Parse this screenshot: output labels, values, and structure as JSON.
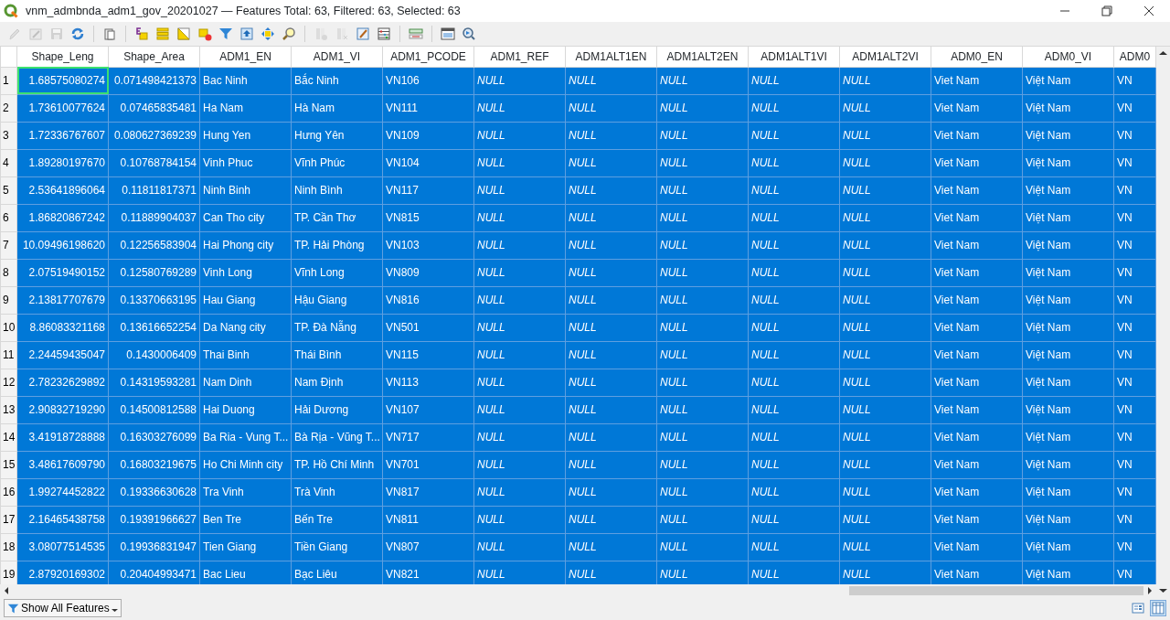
{
  "window": {
    "title": "vnm_admbnda_adm1_gov_20201027 — Features Total: 63, Filtered: 63, Selected: 63"
  },
  "toolbar": [
    {
      "kind": "pencil",
      "disabled": true
    },
    {
      "kind": "multiedit",
      "disabled": true
    },
    {
      "kind": "save",
      "disabled": true
    },
    {
      "kind": "reload",
      "disabled": false
    },
    {
      "kind": "sep"
    },
    {
      "kind": "paste",
      "disabled": false
    },
    {
      "kind": "sep"
    },
    {
      "kind": "expression",
      "disabled": false
    },
    {
      "kind": "selectall",
      "disabled": false
    },
    {
      "kind": "invert",
      "disabled": false
    },
    {
      "kind": "deselect",
      "disabled": false
    },
    {
      "kind": "filter",
      "disabled": false
    },
    {
      "kind": "movetop",
      "disabled": false
    },
    {
      "kind": "pan",
      "disabled": false
    },
    {
      "kind": "zoom",
      "disabled": false
    },
    {
      "kind": "sep"
    },
    {
      "kind": "newfield",
      "disabled": true
    },
    {
      "kind": "deletefield",
      "disabled": true
    },
    {
      "kind": "calculator",
      "disabled": false
    },
    {
      "kind": "abacus",
      "disabled": false
    },
    {
      "kind": "sep"
    },
    {
      "kind": "formatting",
      "disabled": false
    },
    {
      "kind": "sep"
    },
    {
      "kind": "dock",
      "disabled": false
    },
    {
      "kind": "actions",
      "disabled": false
    }
  ],
  "table": {
    "columns": [
      {
        "label": "Shape_Leng",
        "kind": "number"
      },
      {
        "label": "Shape_Area",
        "kind": "number"
      },
      {
        "label": "ADM1_EN",
        "kind": "text"
      },
      {
        "label": "ADM1_VI",
        "kind": "text"
      },
      {
        "label": "ADM1_PCODE",
        "kind": "text"
      },
      {
        "label": "ADM1_REF",
        "kind": "null"
      },
      {
        "label": "ADM1ALT1EN",
        "kind": "null"
      },
      {
        "label": "ADM1ALT2EN",
        "kind": "null"
      },
      {
        "label": "ADM1ALT1VI",
        "kind": "null"
      },
      {
        "label": "ADM1ALT2VI",
        "kind": "null"
      },
      {
        "label": "ADM0_EN",
        "kind": "text"
      },
      {
        "label": "ADM0_VI",
        "kind": "text"
      },
      {
        "label": "ADM0",
        "kind": "text"
      }
    ],
    "rows": [
      {
        "number": "1",
        "selected": true,
        "current": true,
        "cells": [
          "1.68575080274",
          "0.071498421373",
          "Bac Ninh",
          "Bắc Ninh",
          "VN106",
          "NULL",
          "NULL",
          "NULL",
          "NULL",
          "NULL",
          "Viet Nam",
          "Việt Nam",
          "VN"
        ]
      },
      {
        "number": "2",
        "selected": true,
        "current": false,
        "cells": [
          "1.73610077624",
          "0.07465835481",
          "Ha Nam",
          "Hà Nam",
          "VN111",
          "NULL",
          "NULL",
          "NULL",
          "NULL",
          "NULL",
          "Viet Nam",
          "Việt Nam",
          "VN"
        ]
      },
      {
        "number": "3",
        "selected": true,
        "current": false,
        "cells": [
          "1.72336767607",
          "0.080627369239",
          "Hung Yen",
          "Hưng Yên",
          "VN109",
          "NULL",
          "NULL",
          "NULL",
          "NULL",
          "NULL",
          "Viet Nam",
          "Việt Nam",
          "VN"
        ]
      },
      {
        "number": "4",
        "selected": true,
        "current": false,
        "cells": [
          "1.89280197670",
          "0.10768784154",
          "Vinh Phuc",
          "Vĩnh Phúc",
          "VN104",
          "NULL",
          "NULL",
          "NULL",
          "NULL",
          "NULL",
          "Viet Nam",
          "Việt Nam",
          "VN"
        ]
      },
      {
        "number": "5",
        "selected": true,
        "current": false,
        "cells": [
          "2.53641896064",
          "0.11811817371",
          "Ninh Binh",
          "Ninh Bình",
          "VN117",
          "NULL",
          "NULL",
          "NULL",
          "NULL",
          "NULL",
          "Viet Nam",
          "Việt Nam",
          "VN"
        ]
      },
      {
        "number": "6",
        "selected": true,
        "current": false,
        "cells": [
          "1.86820867242",
          "0.11889904037",
          "Can Tho city",
          "TP. Cần Thơ",
          "VN815",
          "NULL",
          "NULL",
          "NULL",
          "NULL",
          "NULL",
          "Viet Nam",
          "Việt Nam",
          "VN"
        ]
      },
      {
        "number": "7",
        "selected": true,
        "current": false,
        "cells": [
          "10.09496198620",
          "0.12256583904",
          "Hai Phong city",
          "TP. Hải Phòng",
          "VN103",
          "NULL",
          "NULL",
          "NULL",
          "NULL",
          "NULL",
          "Viet Nam",
          "Việt Nam",
          "VN"
        ]
      },
      {
        "number": "8",
        "selected": true,
        "current": false,
        "cells": [
          "2.07519490152",
          "0.12580769289",
          "Vinh Long",
          "Vĩnh Long",
          "VN809",
          "NULL",
          "NULL",
          "NULL",
          "NULL",
          "NULL",
          "Viet Nam",
          "Việt Nam",
          "VN"
        ]
      },
      {
        "number": "9",
        "selected": true,
        "current": false,
        "cells": [
          "2.13817707679",
          "0.13370663195",
          "Hau Giang",
          "Hậu Giang",
          "VN816",
          "NULL",
          "NULL",
          "NULL",
          "NULL",
          "NULL",
          "Viet Nam",
          "Việt Nam",
          "VN"
        ]
      },
      {
        "number": "10",
        "selected": true,
        "current": false,
        "cells": [
          "8.86083321168",
          "0.13616652254",
          "Da Nang city",
          "TP. Đà Nẵng",
          "VN501",
          "NULL",
          "NULL",
          "NULL",
          "NULL",
          "NULL",
          "Viet Nam",
          "Việt Nam",
          "VN"
        ]
      },
      {
        "number": "11",
        "selected": true,
        "current": false,
        "cells": [
          "2.24459435047",
          "0.1430006409",
          "Thai Binh",
          "Thái Bình",
          "VN115",
          "NULL",
          "NULL",
          "NULL",
          "NULL",
          "NULL",
          "Viet Nam",
          "Việt Nam",
          "VN"
        ]
      },
      {
        "number": "12",
        "selected": true,
        "current": false,
        "cells": [
          "2.78232629892",
          "0.14319593281",
          "Nam Dinh",
          "Nam Định",
          "VN113",
          "NULL",
          "NULL",
          "NULL",
          "NULL",
          "NULL",
          "Viet Nam",
          "Việt Nam",
          "VN"
        ]
      },
      {
        "number": "13",
        "selected": true,
        "current": false,
        "cells": [
          "2.90832719290",
          "0.14500812588",
          "Hai Duong",
          "Hải Dương",
          "VN107",
          "NULL",
          "NULL",
          "NULL",
          "NULL",
          "NULL",
          "Viet Nam",
          "Việt Nam",
          "VN"
        ]
      },
      {
        "number": "14",
        "selected": true,
        "current": false,
        "cells": [
          "3.41918728888",
          "0.16303276099",
          "Ba Ria - Vung T...",
          "Bà Rịa - Vũng T...",
          "VN717",
          "NULL",
          "NULL",
          "NULL",
          "NULL",
          "NULL",
          "Viet Nam",
          "Việt Nam",
          "VN"
        ]
      },
      {
        "number": "15",
        "selected": true,
        "current": false,
        "cells": [
          "3.48617609790",
          "0.16803219675",
          "Ho Chi Minh city",
          "TP. Hồ Chí Minh",
          "VN701",
          "NULL",
          "NULL",
          "NULL",
          "NULL",
          "NULL",
          "Viet Nam",
          "Việt Nam",
          "VN"
        ]
      },
      {
        "number": "16",
        "selected": true,
        "current": false,
        "cells": [
          "1.99274452822",
          "0.19336630628",
          "Tra Vinh",
          "Trà Vinh",
          "VN817",
          "NULL",
          "NULL",
          "NULL",
          "NULL",
          "NULL",
          "Viet Nam",
          "Việt Nam",
          "VN"
        ]
      },
      {
        "number": "17",
        "selected": true,
        "current": false,
        "cells": [
          "2.16465438758",
          "0.19391966627",
          "Ben Tre",
          "Bến Tre",
          "VN811",
          "NULL",
          "NULL",
          "NULL",
          "NULL",
          "NULL",
          "Viet Nam",
          "Việt Nam",
          "VN"
        ]
      },
      {
        "number": "18",
        "selected": true,
        "current": false,
        "cells": [
          "3.08077514535",
          "0.19936831947",
          "Tien Giang",
          "Tiền Giang",
          "VN807",
          "NULL",
          "NULL",
          "NULL",
          "NULL",
          "NULL",
          "Viet Nam",
          "Việt Nam",
          "VN"
        ]
      },
      {
        "number": "19",
        "selected": true,
        "current": false,
        "cells": [
          "2.87920169302",
          "0.20404993471",
          "Bac Lieu",
          "Bạc Liêu",
          "VN821",
          "NULL",
          "NULL",
          "NULL",
          "NULL",
          "NULL",
          "Viet Nam",
          "Việt Nam",
          "VN"
        ]
      }
    ]
  },
  "footer": {
    "filter_button": "Show All Features",
    "views": [
      {
        "kind": "form",
        "selected": false
      },
      {
        "kind": "table",
        "selected": true
      }
    ]
  }
}
